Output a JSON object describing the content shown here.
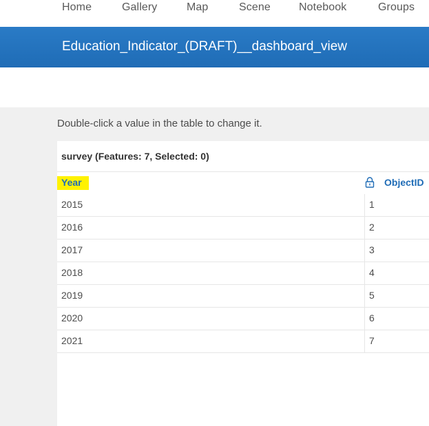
{
  "nav": {
    "items": [
      "Home",
      "Gallery",
      "Map",
      "Scene",
      "Notebook",
      "Groups"
    ]
  },
  "header": {
    "title": "Education_Indicator_(DRAFT)__dashboard_view"
  },
  "hint": "Double-click a value in the table to change it.",
  "table": {
    "title": "survey (Features: 7, Selected: 0)",
    "columns": [
      "Year",
      "ObjectID"
    ],
    "rows": [
      {
        "year": "2015",
        "objectid": "1"
      },
      {
        "year": "2016",
        "objectid": "2"
      },
      {
        "year": "2017",
        "objectid": "3"
      },
      {
        "year": "2018",
        "objectid": "4"
      },
      {
        "year": "2019",
        "objectid": "5"
      },
      {
        "year": "2020",
        "objectid": "6"
      },
      {
        "year": "2021",
        "objectid": "7"
      }
    ]
  },
  "colors": {
    "accent": "#1f6cb6",
    "highlight": "#fff200",
    "background_gray": "#f0f0f0"
  },
  "icons": {
    "objectid_lock": "lock-icon"
  }
}
